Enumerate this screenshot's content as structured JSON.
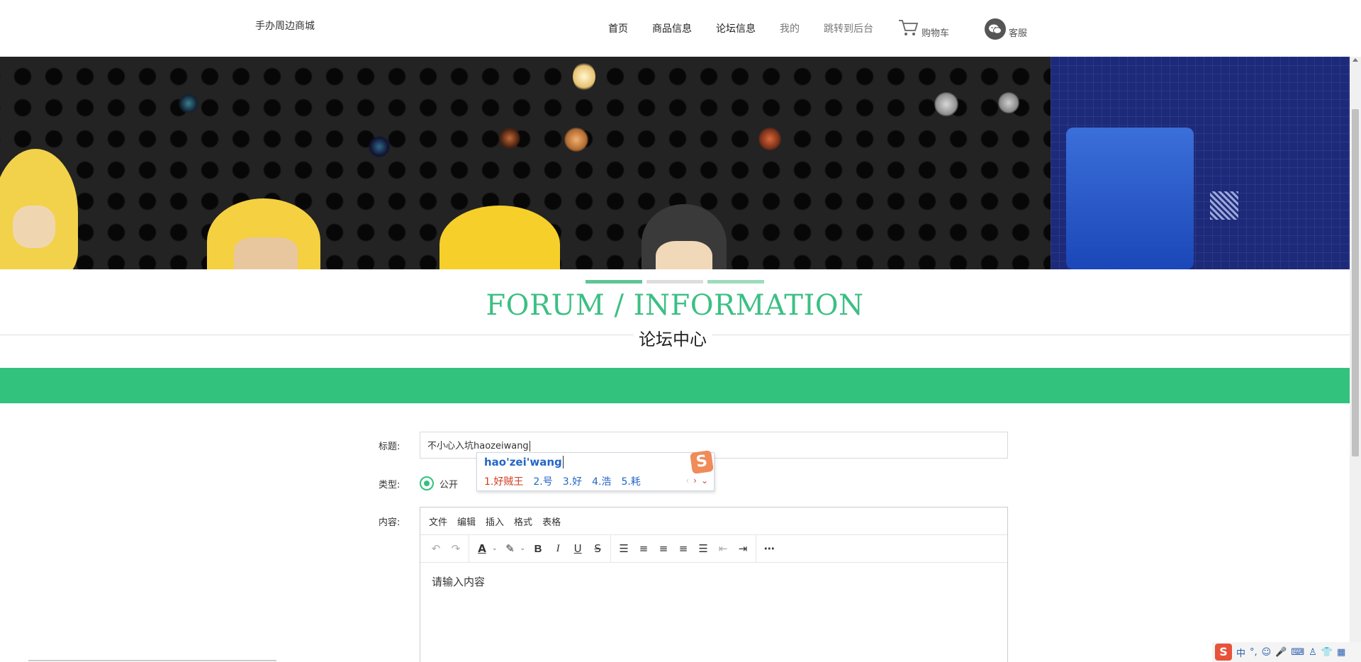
{
  "header": {
    "brand": "手办周边商城",
    "nav": [
      {
        "label": "首页"
      },
      {
        "label": "商品信息"
      },
      {
        "label": "论坛信息"
      },
      {
        "label": "我的"
      },
      {
        "label": "跳转到后台"
      }
    ],
    "cart_label": "购物车",
    "service_label": "客服",
    "cart_icon": "cart-icon",
    "service_icon": "wechat-icon"
  },
  "section": {
    "title_en": "FORUM / INFORMATION",
    "title_cn": "论坛中心"
  },
  "form": {
    "title_label": "标题:",
    "title_value": "不小心入坑haozeiwang",
    "type_label": "类型:",
    "type_option": "公开",
    "content_label": "内容:"
  },
  "ime": {
    "composition": "hao'zei'wang",
    "candidates": [
      "1.好贼王",
      "2.号",
      "3.好",
      "4.浩",
      "5.耗"
    ]
  },
  "editor": {
    "menu": [
      "文件",
      "编辑",
      "插入",
      "格式",
      "表格"
    ],
    "placeholder": "请输入内容"
  },
  "tray": {
    "items": [
      "中",
      "°,"
    ]
  },
  "colors": {
    "accent": "#33c17e",
    "title_green": "#3cbf84"
  }
}
